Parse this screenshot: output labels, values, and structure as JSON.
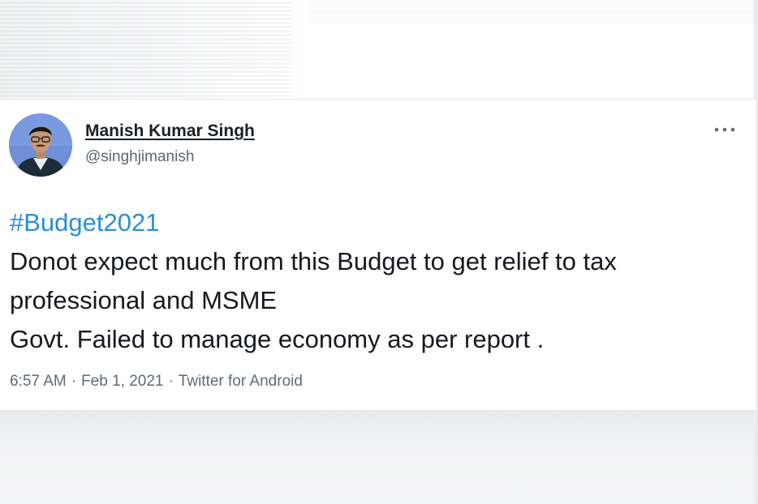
{
  "author": {
    "display_name": "Manish Kumar Singh",
    "handle": "@singhjimanish"
  },
  "more_icon": "more-horizontal-icon",
  "tweet": {
    "hashtag": "#Budget2021",
    "lines": [
      "Donot expect much from this Budget to get relief to tax",
      "professional and MSME",
      "Govt. Failed to manage economy as per report ."
    ]
  },
  "meta": {
    "time": "6:57 AM",
    "separator": "·",
    "date": "Feb 1, 2021",
    "source": "Twitter for Android"
  },
  "colors": {
    "hashtag": "#2b8fd6",
    "text": "#16191d",
    "secondary": "#5f6b75",
    "avatar_bg": "#6f8fd9"
  }
}
